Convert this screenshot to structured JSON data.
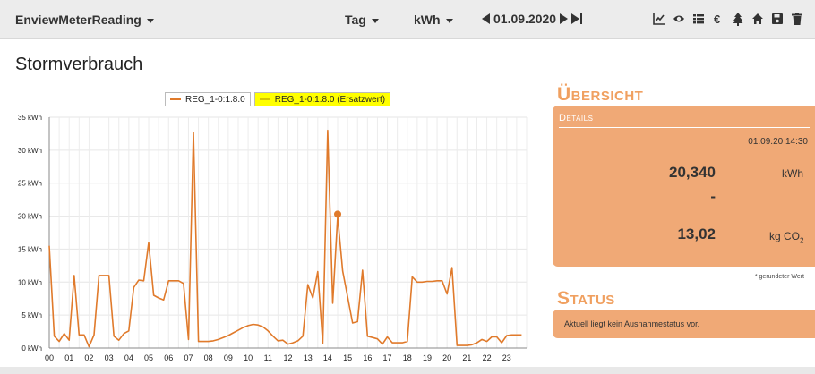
{
  "topbar": {
    "app_name": "EnviewMeterReading",
    "period": "Tag",
    "unit": "kWh",
    "date": "01.09.2020",
    "icons": [
      "chart-line-icon",
      "eye-icon",
      "list-icon",
      "euro-icon",
      "tree-icon",
      "home-icon",
      "save-icon",
      "trash-icon"
    ]
  },
  "page": {
    "title": "Stormverbrauch"
  },
  "chart_data": {
    "type": "line",
    "title": "",
    "xlabel": "",
    "ylabel": "",
    "ylim": [
      0,
      35
    ],
    "yticks": [
      "0 kWh",
      "5 kWh",
      "10 kWh",
      "15 kWh",
      "20 kWh",
      "25 kWh",
      "30 kWh",
      "35 kWh"
    ],
    "xlim": [
      0,
      24
    ],
    "xticks": [
      "00",
      "01",
      "02",
      "03",
      "04",
      "05",
      "06",
      "07",
      "08",
      "09",
      "10",
      "11",
      "12",
      "13",
      "14",
      "15",
      "16",
      "17",
      "18",
      "19",
      "20",
      "21",
      "22",
      "23"
    ],
    "grid": true,
    "legend_position": "top",
    "series": [
      {
        "name": "REG_1-0:1.8.0",
        "color": "#e07a2b",
        "points": [
          [
            0.0,
            15.5
          ],
          [
            0.25,
            1.8
          ],
          [
            0.5,
            1.0
          ],
          [
            0.75,
            2.2
          ],
          [
            1.0,
            1.2
          ],
          [
            1.25,
            11.0
          ],
          [
            1.5,
            2.0
          ],
          [
            1.75,
            2.0
          ],
          [
            2.0,
            0.2
          ],
          [
            2.25,
            2.0
          ],
          [
            2.5,
            11.0
          ],
          [
            2.75,
            11.0
          ],
          [
            3.0,
            11.0
          ],
          [
            3.25,
            1.8
          ],
          [
            3.5,
            1.2
          ],
          [
            3.75,
            2.2
          ],
          [
            4.0,
            2.6
          ],
          [
            4.25,
            9.2
          ],
          [
            4.5,
            10.3
          ],
          [
            4.75,
            10.2
          ],
          [
            5.0,
            16.0
          ],
          [
            5.25,
            8.0
          ],
          [
            5.5,
            7.6
          ],
          [
            5.75,
            7.3
          ],
          [
            6.0,
            10.2
          ],
          [
            6.25,
            10.2
          ],
          [
            6.5,
            10.2
          ],
          [
            6.75,
            9.8
          ],
          [
            7.0,
            1.3
          ],
          [
            7.25,
            32.7
          ],
          [
            7.5,
            1.0
          ],
          [
            7.75,
            1.0
          ],
          [
            8.0,
            1.0
          ],
          [
            8.25,
            1.1
          ],
          [
            8.5,
            1.3
          ],
          [
            8.75,
            1.6
          ],
          [
            9.0,
            1.9
          ],
          [
            9.25,
            2.3
          ],
          [
            9.5,
            2.7
          ],
          [
            9.75,
            3.1
          ],
          [
            10.0,
            3.4
          ],
          [
            10.25,
            3.6
          ],
          [
            10.5,
            3.5
          ],
          [
            10.75,
            3.2
          ],
          [
            11.0,
            2.6
          ],
          [
            11.25,
            1.8
          ],
          [
            11.5,
            1.1
          ],
          [
            11.75,
            1.2
          ],
          [
            12.0,
            0.6
          ],
          [
            12.25,
            0.8
          ],
          [
            12.5,
            1.1
          ],
          [
            12.75,
            1.8
          ],
          [
            13.0,
            9.6
          ],
          [
            13.25,
            7.6
          ],
          [
            13.5,
            11.6
          ],
          [
            13.75,
            0.7
          ],
          [
            14.0,
            33.0
          ],
          [
            14.25,
            6.8
          ],
          [
            14.5,
            20.0
          ],
          [
            14.75,
            11.7
          ],
          [
            15.0,
            7.8
          ],
          [
            15.25,
            3.8
          ],
          [
            15.5,
            4.0
          ],
          [
            15.75,
            11.8
          ],
          [
            16.0,
            1.8
          ],
          [
            16.25,
            1.6
          ],
          [
            16.5,
            1.4
          ],
          [
            16.75,
            0.6
          ],
          [
            17.0,
            1.7
          ],
          [
            17.25,
            0.8
          ],
          [
            17.5,
            0.8
          ],
          [
            17.75,
            0.8
          ],
          [
            18.0,
            1.0
          ],
          [
            18.25,
            10.8
          ],
          [
            18.5,
            10.0
          ],
          [
            18.75,
            10.0
          ],
          [
            19.0,
            10.1
          ],
          [
            19.25,
            10.1
          ],
          [
            19.5,
            10.2
          ],
          [
            19.75,
            10.2
          ],
          [
            20.0,
            8.2
          ],
          [
            20.25,
            12.2
          ],
          [
            20.5,
            0.4
          ],
          [
            20.75,
            0.4
          ],
          [
            21.0,
            0.4
          ],
          [
            21.25,
            0.5
          ],
          [
            21.5,
            0.8
          ],
          [
            21.75,
            1.3
          ],
          [
            22.0,
            1.0
          ],
          [
            22.25,
            1.7
          ],
          [
            22.5,
            1.7
          ],
          [
            22.75,
            0.8
          ],
          [
            23.0,
            1.9
          ],
          [
            23.25,
            2.0
          ],
          [
            23.5,
            2.0
          ],
          [
            23.75,
            2.0
          ]
        ]
      },
      {
        "name": "REG_1-0:1.8.0 (Ersatzwert)",
        "color": "#d6c600",
        "points": []
      }
    ],
    "highlight_point": {
      "x": 14.5,
      "y": 20.3
    }
  },
  "overview": {
    "heading": "Übersicht",
    "details_label": "Details",
    "timestamp": "01.09.20 14:30",
    "value": "20,340",
    "value_unit": "kWh",
    "dash": "-",
    "co2_value": "13,02",
    "co2_unit_main": "kg CO",
    "co2_unit_sub": "2",
    "footnote": "* gerundeter Wert"
  },
  "status": {
    "heading": "Status",
    "text": "Aktuell liegt kein Ausnahmestatus vor."
  }
}
